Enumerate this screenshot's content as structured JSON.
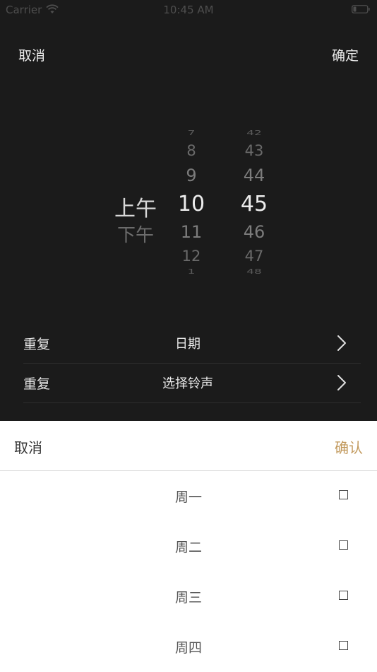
{
  "status_bar": {
    "carrier": "Carrier",
    "time": "10:45 AM",
    "wifi_icon": "wifi-icon",
    "battery_icon": "battery-icon"
  },
  "top_actions": {
    "cancel": "取消",
    "confirm": "确定"
  },
  "time_picker": {
    "ampm": {
      "selected": "上午",
      "other": "下午"
    },
    "hours": {
      "edge_top": "7",
      "far_top": "8",
      "near_top": "9",
      "selected": "10",
      "near_bottom": "11",
      "far_bottom": "12",
      "edge_bottom": "1"
    },
    "minutes": {
      "edge_top": "42",
      "far_top": "43",
      "near_top": "44",
      "selected": "45",
      "near_bottom": "46",
      "far_bottom": "47",
      "edge_bottom": "48"
    }
  },
  "settings": {
    "rows": [
      {
        "label": "重复",
        "value": "日期",
        "icon": "chevron-right-icon"
      },
      {
        "label": "重复",
        "value": "选择铃声",
        "icon": "chevron-right-icon"
      }
    ]
  },
  "sheet": {
    "cancel": "取消",
    "confirm": "确认",
    "confirm_color": "#c29a5e",
    "days": [
      {
        "label": "周一",
        "checked": false
      },
      {
        "label": "周二",
        "checked": false
      },
      {
        "label": "周三",
        "checked": false
      },
      {
        "label": "周四",
        "checked": false
      }
    ]
  }
}
